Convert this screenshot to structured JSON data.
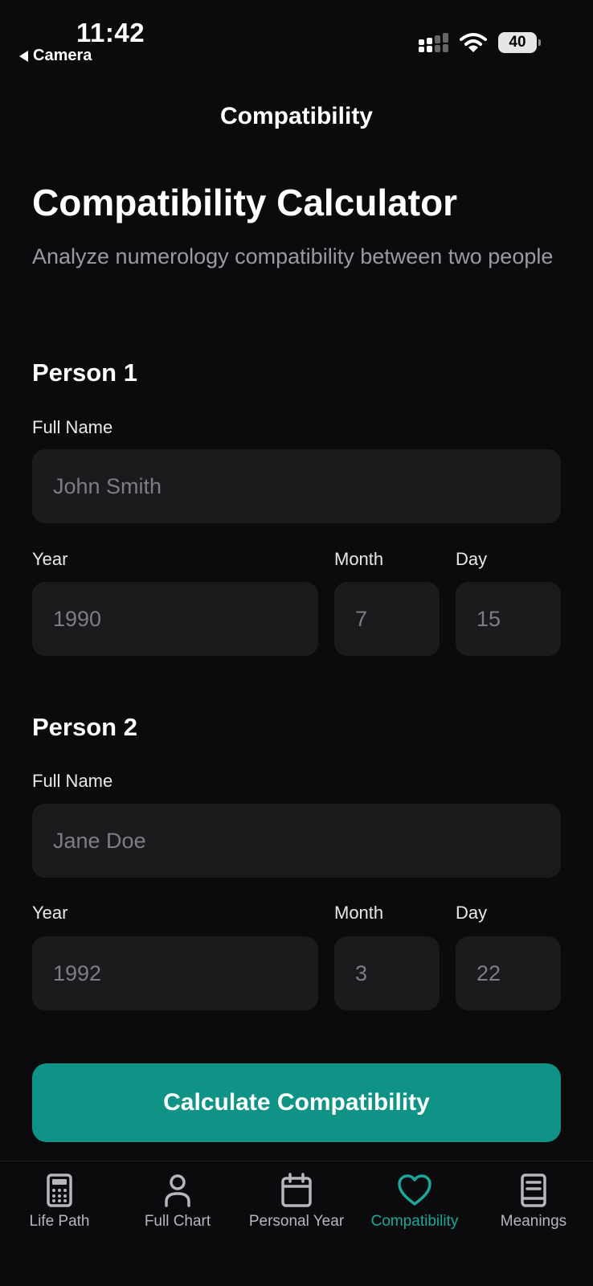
{
  "status": {
    "time": "11:42",
    "back_label": "Camera",
    "battery": "40"
  },
  "nav": {
    "title": "Compatibility"
  },
  "header": {
    "title": "Compatibility Calculator",
    "subtitle": "Analyze numerology compatibility between two people"
  },
  "person1": {
    "heading": "Person 1",
    "name_label": "Full Name",
    "name_placeholder": "John Smith",
    "year_label": "Year",
    "year_placeholder": "1990",
    "month_label": "Month",
    "month_placeholder": "7",
    "day_label": "Day",
    "day_placeholder": "15"
  },
  "person2": {
    "heading": "Person 2",
    "name_label": "Full Name",
    "name_placeholder": "Jane Doe",
    "year_label": "Year",
    "year_placeholder": "1992",
    "month_label": "Month",
    "month_placeholder": "3",
    "day_label": "Day",
    "day_placeholder": "22"
  },
  "calculate_label": "Calculate Compatibility",
  "tabs": [
    {
      "label": "Life Path",
      "icon": "calculator-icon"
    },
    {
      "label": "Full Chart",
      "icon": "person-icon"
    },
    {
      "label": "Personal Year",
      "icon": "calendar-icon"
    },
    {
      "label": "Compatibility",
      "icon": "heart-icon",
      "active": true
    },
    {
      "label": "Meanings",
      "icon": "book-icon"
    }
  ],
  "colors": {
    "accent": "#0e9386",
    "active_tab": "#17a89a",
    "background": "#0b0b0d",
    "field": "#1b1b1e"
  }
}
